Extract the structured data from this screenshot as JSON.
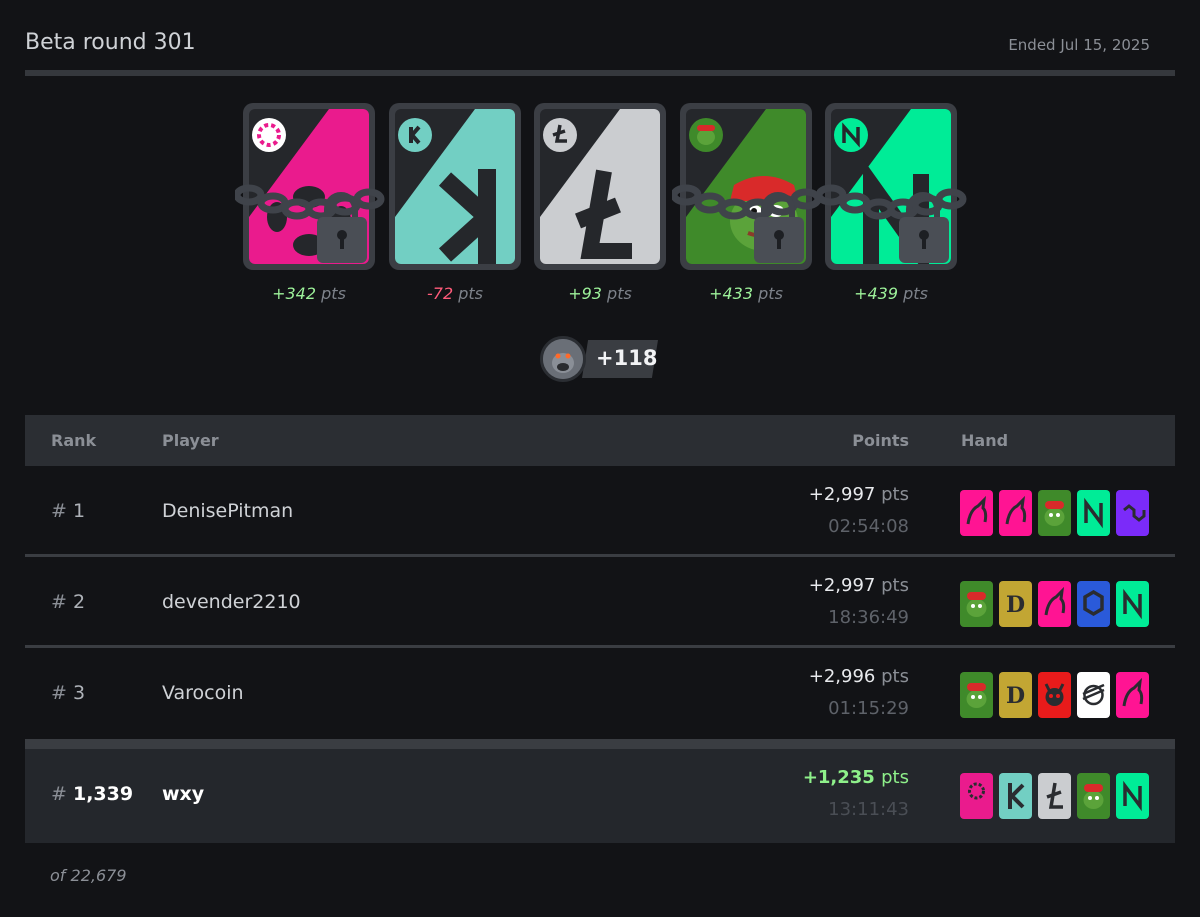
{
  "header": {
    "title": "Beta round 301",
    "ended": "Ended Jul 15, 2025"
  },
  "cards": [
    {
      "token": "polkadot",
      "color": "#ea1b8d",
      "points": "+342",
      "unit": "pts",
      "locked": true
    },
    {
      "token": "kaspa",
      "color": "#72cfc3",
      "points": "-72",
      "unit": "pts",
      "locked": false
    },
    {
      "token": "litecoin",
      "color": "#cbcdd0",
      "points": "+93",
      "unit": "pts",
      "locked": false
    },
    {
      "token": "pepe",
      "color": "#3f8a2a",
      "points": "+433",
      "unit": "pts",
      "locked": true
    },
    {
      "token": "near",
      "color": "#00ec97",
      "points": "+439",
      "unit": "pts",
      "locked": true
    }
  ],
  "bonus": {
    "value": "+118"
  },
  "table": {
    "headers": {
      "rank": "Rank",
      "player": "Player",
      "points": "Points",
      "hand": "Hand"
    },
    "rows": [
      {
        "rank_hash": "#",
        "rank": "1",
        "player": "DenisePitman",
        "points": "+2,997",
        "unit": "pts",
        "time": "02:54:08",
        "hand": [
          "unicorn",
          "unicorn",
          "pepe",
          "near",
          "polygon"
        ]
      },
      {
        "rank_hash": "#",
        "rank": "2",
        "player": "devender2210",
        "points": "+2,997",
        "unit": "pts",
        "time": "18:36:49",
        "hand": [
          "pepe",
          "doge",
          "unicorn",
          "chainlink",
          "near"
        ]
      },
      {
        "rank_hash": "#",
        "rank": "3",
        "player": "Varocoin",
        "points": "+2,996",
        "unit": "pts",
        "time": "01:15:29",
        "hand": [
          "pepe",
          "doge",
          "devil",
          "stellar",
          "unicorn"
        ]
      }
    ],
    "me": {
      "rank_hash": "#",
      "rank": "1,339",
      "player": "wxy",
      "points": "+1,235",
      "unit": "pts",
      "time": "13:11:43",
      "hand": [
        "polkadot",
        "kaspa",
        "litecoin",
        "pepe",
        "near"
      ]
    },
    "total": "of 22,679"
  },
  "colors": {
    "polkadot": "#ea1b8d",
    "kaspa": "#72cfc3",
    "litecoin": "#cbcdd0",
    "pepe": "#3f8a2a",
    "near": "#00ec97",
    "unicorn": "#ff1493",
    "polygon": "#7b2bf9",
    "doge": "#c2a633",
    "chainlink": "#2a5ada",
    "devil": "#e81b1b",
    "stellar": "#ffffff"
  }
}
